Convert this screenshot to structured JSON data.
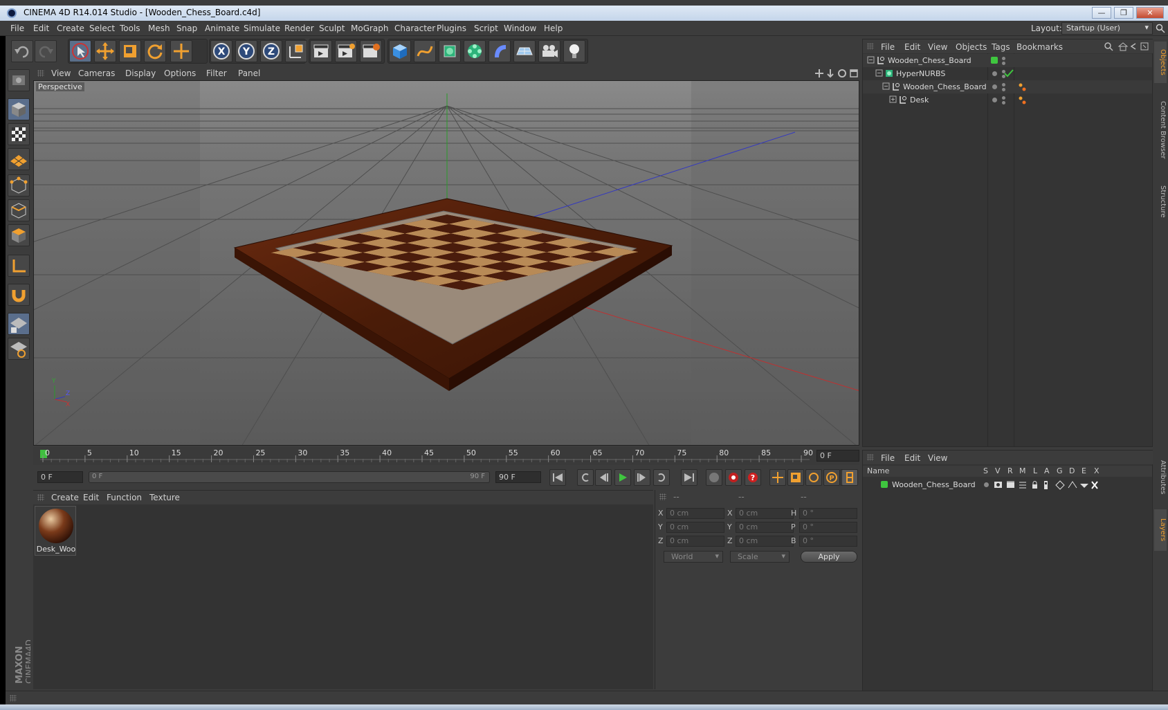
{
  "window": {
    "title": "CINEMA 4D R14.014 Studio - [Wooden_Chess_Board.c4d]",
    "minimize": "—",
    "restore": "❐",
    "close": "✕"
  },
  "menu": [
    "File",
    "Edit",
    "Create",
    "Select",
    "Tools",
    "Mesh",
    "Snap",
    "Animate",
    "Simulate",
    "Render",
    "Sculpt",
    "MoGraph",
    "Character",
    "Plugins",
    "Script",
    "Window",
    "Help"
  ],
  "layout": {
    "label": "Layout:",
    "value": "Startup (User)"
  },
  "viewport": {
    "menu": [
      "View",
      "Cameras",
      "Display",
      "Options",
      "Filter",
      "Panel"
    ],
    "label": "Perspective"
  },
  "timeline": {
    "ticks": [
      "0",
      "5",
      "10",
      "15",
      "20",
      "25",
      "30",
      "35",
      "40",
      "45",
      "50",
      "55",
      "60",
      "65",
      "70",
      "75",
      "80",
      "85",
      "90"
    ],
    "current_frame": "0 F",
    "start_frame": "0 F",
    "range_start": "0 F",
    "range_end": "90 F",
    "end_frame": "90 F"
  },
  "material_manager": {
    "menu": [
      "Create",
      "Edit",
      "Function",
      "Texture"
    ],
    "materials": [
      {
        "name": "Desk_Woo"
      }
    ]
  },
  "coordinates": {
    "headers": [
      "--",
      "--",
      "--"
    ],
    "rows": [
      {
        "l1": "X",
        "v1": "0 cm",
        "l2": "X",
        "v2": "0 cm",
        "l3": "H",
        "v3": "0 °"
      },
      {
        "l1": "Y",
        "v1": "0 cm",
        "l2": "Y",
        "v2": "0 cm",
        "l3": "P",
        "v3": "0 °"
      },
      {
        "l1": "Z",
        "v1": "0 cm",
        "l2": "Z",
        "v2": "0 cm",
        "l3": "B",
        "v3": "0 °"
      }
    ],
    "mode": "World",
    "type": "Scale",
    "apply": "Apply"
  },
  "object_manager": {
    "menu": [
      "File",
      "Edit",
      "View",
      "Objects",
      "Tags",
      "Bookmarks"
    ],
    "objects": [
      {
        "name": "Wooden_Chess_Board",
        "indent": 0
      },
      {
        "name": "HyperNURBS",
        "indent": 1
      },
      {
        "name": "Wooden_Chess_Board",
        "indent": 2
      },
      {
        "name": "Desk",
        "indent": 3
      }
    ]
  },
  "layer_manager": {
    "menu": [
      "File",
      "Edit",
      "View"
    ],
    "columns": [
      "Name",
      "S",
      "V",
      "R",
      "M",
      "L",
      "A",
      "G",
      "D",
      "E",
      "X"
    ],
    "layers": [
      {
        "name": "Wooden_Chess_Board",
        "color": "#3fc63f"
      }
    ]
  },
  "side_tabs": [
    "Objects",
    "Content Browser",
    "Structure",
    "Attributes",
    "Layers"
  ],
  "branding": "MAXON CINEMA 4D",
  "colors": {
    "accent": "#f0a030",
    "axis_x": "#c03030",
    "axis_y": "#30a030",
    "axis_z": "#3040c0"
  }
}
